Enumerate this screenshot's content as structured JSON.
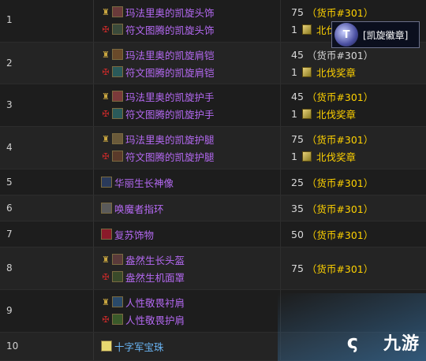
{
  "rows": [
    {
      "index": "1",
      "alliance_item": "玛法里奥的凯旋头饰",
      "horde_item": "符文图腾的凯旋头饰",
      "cost_top_num": "75",
      "cost_top_cur": "（货币#301）",
      "cost_bottom_num": "1",
      "cost_bottom_cur": "北伐"
    },
    {
      "index": "2",
      "alliance_item": "玛法里奥的凯旋肩铠",
      "horde_item": "符文图腾的凯旋肩铠",
      "cost_top_num": "45",
      "cost_top_cur": "（货币#301）",
      "cost_bottom_num": "1",
      "cost_bottom_cur": "北伐奖章"
    },
    {
      "index": "3",
      "alliance_item": "玛法里奥的凯旋护手",
      "horde_item": "符文图腾的凯旋护手",
      "cost_top_num": "45",
      "cost_top_cur": "（货币#301）",
      "cost_bottom_num": "1",
      "cost_bottom_cur": "北伐奖章"
    },
    {
      "index": "4",
      "alliance_item": "玛法里奥的凯旋护腿",
      "horde_item": "符文图腾的凯旋护腿",
      "cost_top_num": "75",
      "cost_top_cur": "（货币#301）",
      "cost_bottom_num": "1",
      "cost_bottom_cur": "北伐奖章"
    },
    {
      "index": "5",
      "item": "华丽生长神像",
      "cost_num": "25",
      "cost_cur": "（货币#301）"
    },
    {
      "index": "6",
      "item": "唤魔者指环",
      "cost_num": "35",
      "cost_cur": "（货币#301）"
    },
    {
      "index": "7",
      "item": "复苏饰物",
      "cost_num": "50",
      "cost_cur": "（货币#301）"
    },
    {
      "index": "8",
      "alliance_item": "盎然生长头盔",
      "horde_item": "盎然生机面罩",
      "cost_num": "75",
      "cost_cur": "（货币#301）"
    },
    {
      "index": "9",
      "alliance_item": "人性敬畏衬肩",
      "horde_item": "人性敬畏护肩"
    },
    {
      "index": "10",
      "item": "十字军宝珠"
    }
  ],
  "tooltip": {
    "label": "[凯旋徽章]"
  },
  "watermark": {
    "text": "九游"
  },
  "colors": {
    "epic": "#b469f2",
    "rare": "#69b3f2",
    "currency": "#ffd200",
    "alliance": "#c9a640",
    "horde": "#c22a2a"
  }
}
